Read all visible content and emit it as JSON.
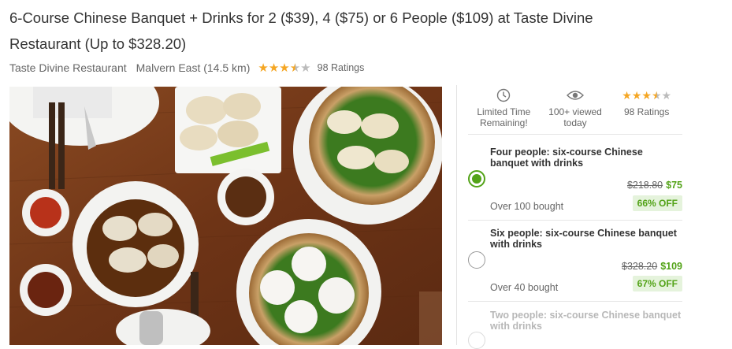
{
  "deal": {
    "title": "6-Course Chinese Banquet + Drinks for 2 ($39), 4 ($75) or 6 People ($109) at Taste Divine Restaurant (Up to $328.20)",
    "merchant": "Taste Divine Restaurant",
    "location": "Malvern East (14.5 km)",
    "rating_value": 3.5,
    "rating_max": 5,
    "ratings_count": "98 Ratings"
  },
  "image": {
    "description": "Chinese dumplings, dim sum and sauces on a wooden table"
  },
  "stats": {
    "limited_time": "Limited Time Remaining!",
    "viewed": "100+ viewed today",
    "ratings": "98 Ratings",
    "icons": [
      "clock-icon",
      "eye-icon",
      "star-rating"
    ]
  },
  "options": [
    {
      "title": "Four people: six-course Chinese banquet with drinks",
      "original_price": "$218.80",
      "price": "$75",
      "bought": "Over 100 bought",
      "discount": "66% OFF",
      "selected": true
    },
    {
      "title": "Six people: six-course Chinese banquet with drinks",
      "original_price": "$328.20",
      "price": "$109",
      "bought": "Over 40 bought",
      "discount": "67% OFF",
      "selected": false
    },
    {
      "title": "Two people: six-course Chinese banquet with drinks",
      "selected": false
    }
  ],
  "colors": {
    "accent_green": "#53a318",
    "star_gold": "#f5a623",
    "star_grey": "#bbbbbb",
    "badge_bg": "#e5f3dc"
  }
}
